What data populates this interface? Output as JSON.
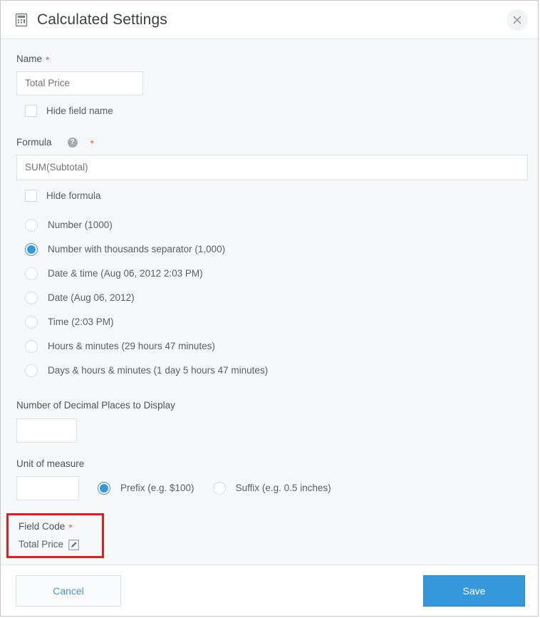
{
  "header": {
    "icon": "calculator-icon",
    "title": "Calculated Settings",
    "close_icon": "close-icon"
  },
  "form": {
    "name": {
      "label": "Name",
      "required_marker": "*",
      "value": "Total Price",
      "placeholder": "Total Price",
      "hide_checkbox_label": "Hide field name",
      "hide_checked": false
    },
    "formula": {
      "label": "Formula",
      "help_icon": "help-icon",
      "help_glyph": "?",
      "required_marker": "*",
      "value": "SUM(Subtotal)",
      "placeholder": "SUM(Subtotal)",
      "hide_checkbox_label": "Hide formula",
      "hide_checked": false
    },
    "display_format": {
      "selected_index": 1,
      "options": [
        {
          "label": "Number (1000)",
          "checked": false
        },
        {
          "label": "Number with thousands separator (1,000)",
          "checked": true
        },
        {
          "label": "Date & time (Aug 06, 2012 2:03 PM)",
          "checked": false
        },
        {
          "label": "Date (Aug 06, 2012)",
          "checked": false
        },
        {
          "label": "Time (2:03 PM)",
          "checked": false
        },
        {
          "label": "Hours & minutes (29 hours 47 minutes)",
          "checked": false
        },
        {
          "label": "Days & hours & minutes (1 day 5 hours 47 minutes)",
          "checked": false
        }
      ]
    },
    "decimal_places": {
      "label": "Number of Decimal Places to Display",
      "value": "",
      "placeholder": ""
    },
    "unit_of_measure": {
      "label": "Unit of measure",
      "value": "",
      "placeholder": "",
      "position_selected_index": 0,
      "position_options": [
        {
          "label": "Prefix (e.g. $100)",
          "checked": true
        },
        {
          "label": "Suffix (e.g. 0.5 inches)",
          "checked": false
        }
      ]
    },
    "field_code": {
      "label": "Field Code",
      "required_marker": "*",
      "value": "Total Price",
      "edit_icon": "edit-icon",
      "highlight_color": "#e51c1c"
    }
  },
  "footer": {
    "cancel_label": "Cancel",
    "save_label": "Save"
  },
  "colors": {
    "accent_blue": "#3498db",
    "required_red": "#e8604c",
    "annotation_red": "#e51c1c",
    "body_background": "#f7f8fa"
  }
}
